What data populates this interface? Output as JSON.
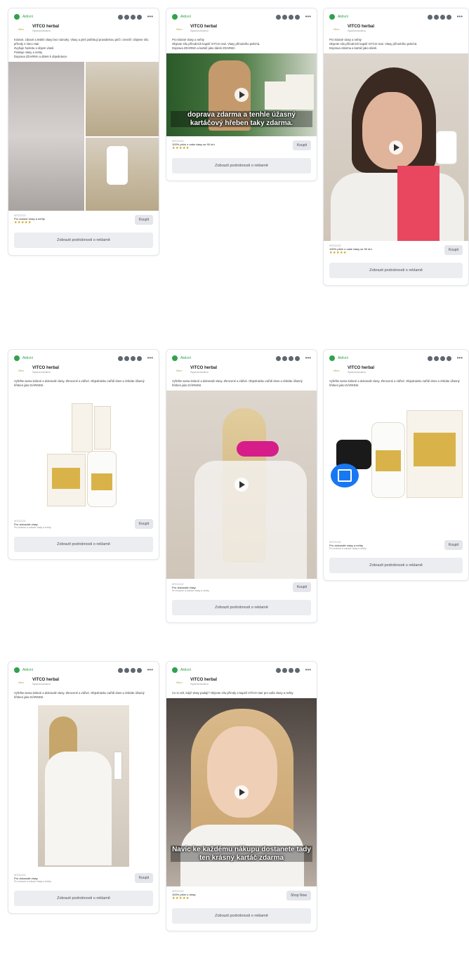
{
  "cards": [
    {
      "status": "Aktivní",
      "advertiser": "VITCO herbal",
      "sponsored": "Sponzorováno",
      "body": [
        "Krásné, zdravé a lesklé vlasy bez námahy. Vlasy a pleť potřebují pravidelnou péči i zevnitř. Objevte sílu přírody s Vitco Hair.",
        "Zvyšuje hustotu a objem vlasů",
        "Posiluje vlasy a nehty",
        "Doprava ZDARMA a dárek k objednávce"
      ],
      "footer_domain": "VITCO.CZ",
      "footer_title": "Pro zdravé vlasy a nehty",
      "footer_sub": "",
      "stars": "★★★★★",
      "cta": "Koupit",
      "details": "Zobrazit podrobnosti o reklamě",
      "caption": ""
    },
    {
      "status": "Aktivní",
      "advertiser": "VITCO herbal",
      "sponsored": "Sponzorováno",
      "body": [
        "Pro krásné vlasy a nehty",
        "Objevte sílu přírodních kapslí VITCO Hair. Vlasy přírodního pelichá.",
        "Doprava ZDARMA a kartáč jako dárek ZDARMA"
      ],
      "footer_domain": "VITCO.CZ",
      "footer_title": "100% péče o vaše vlasy se 90 dní",
      "footer_sub": "",
      "stars": "★★★★★",
      "cta": "Koupit",
      "details": "Zobrazit podrobnosti o reklamě",
      "caption": "doprava zdarma a tenhle úžasný kartáčový hřeben taky zdarma."
    },
    {
      "status": "Aktivní",
      "advertiser": "VITCO herbal",
      "sponsored": "Sponzorováno",
      "body": [
        "Pro krásné vlasy a nehty",
        "Objevte sílu přírodních kapslí VITCO Hair. Vlasy přírodního pelichá.",
        "Doprava zdarma a kartáč jako dárek"
      ],
      "footer_domain": "VITCO.CZ",
      "footer_title": "100% péče o vaše vlasy se 90 dní",
      "footer_sub": "",
      "stars": "★★★★★",
      "cta": "Koupit",
      "details": "Zobrazit podrobnosti o reklamě",
      "caption": ""
    },
    {
      "status": "Aktivní",
      "advertiser": "VITCO herbal",
      "sponsored": "Sponzorováno",
      "body": [
        "Vyřešte sama krásné a dokonalé vlasy. Zkrocené a zářivé. Objednávku zařídí dnes a získáte úžasný hřeben jako DÁRKEM."
      ],
      "footer_domain": "VITCO.CZ",
      "footer_title": "Pro dokonalé vlasy",
      "footer_sub": "Pro krásné a zdravé vlasy a nehty",
      "stars": "",
      "cta": "Koupit",
      "details": "Zobrazit podrobnosti o reklamě",
      "caption": ""
    },
    {
      "status": "Aktivní",
      "advertiser": "VITCO herbal",
      "sponsored": "Sponzorováno",
      "body": [
        "Vyřešte sama krásné a dokonalé vlasy. Zkrocené a zářivé. Objednávku zařídí dnes a získáte úžasný hřeben jako DÁRKEM."
      ],
      "footer_domain": "VITCO.CZ",
      "footer_title": "Pro dokonalé vlasy",
      "footer_sub": "Pro krásné a zdravé vlasy a nehty",
      "stars": "",
      "cta": "Koupit",
      "details": "Zobrazit podrobnosti o reklamě",
      "caption": ""
    },
    {
      "status": "Aktivní",
      "advertiser": "VITCO herbal",
      "sponsored": "Sponzorováno",
      "body": [
        "Vyřešte sama krásné a dokonalé vlasy. Zkrocené a zářivé. Objednávku zařídí dnes a získáte úžasný hřeben jako DÁRKEM."
      ],
      "footer_domain": "VITCO.CZ",
      "footer_title": "Pro dokonalé vlasy a nehty",
      "footer_sub": "Pro krásné a zdravé vlasy a nehty",
      "stars": "",
      "cta": "Koupit",
      "details": "Zobrazit podrobnosti o reklamě",
      "caption": ""
    },
    {
      "status": "Aktivní",
      "advertiser": "VITCO herbal",
      "sponsored": "Sponzorováno",
      "body": [
        "Vyřešte sama krásné a dokonalé vlasy. Zkrocené a zářivé. Objednávku zařídí dnes a získáte úžasný hřeben jako DÁRKEM."
      ],
      "footer_domain": "VITCO.CZ",
      "footer_title": "Pro dokonalé vlasy",
      "footer_sub": "Pro krásné a zdravé vlasy a nehty",
      "stars": "",
      "cta": "Koupit",
      "details": "Zobrazit podrobnosti o reklamě",
      "caption": ""
    },
    {
      "status": "Aktivní",
      "advertiser": "VITCO herbal",
      "sponsored": "Sponzorováno",
      "body": [
        "Co si vzít, když vlasy padají? Objevte sílu přírody a kapslí VITCO Hair pro vaše vlasy a nehty."
      ],
      "footer_domain": "VITCO.CZ",
      "footer_title": "100% péče o vlasy",
      "footer_sub": "",
      "stars": "★★★★★",
      "cta": "Shop Now",
      "details": "Zobrazit podrobnosti o reklamě",
      "caption": "Navíc ke každému nákupu dostanete tady ten krásný kartáč zdarma"
    }
  ],
  "colors": {
    "status_green": "#31a24c",
    "brand_gold": "#c59b00"
  }
}
